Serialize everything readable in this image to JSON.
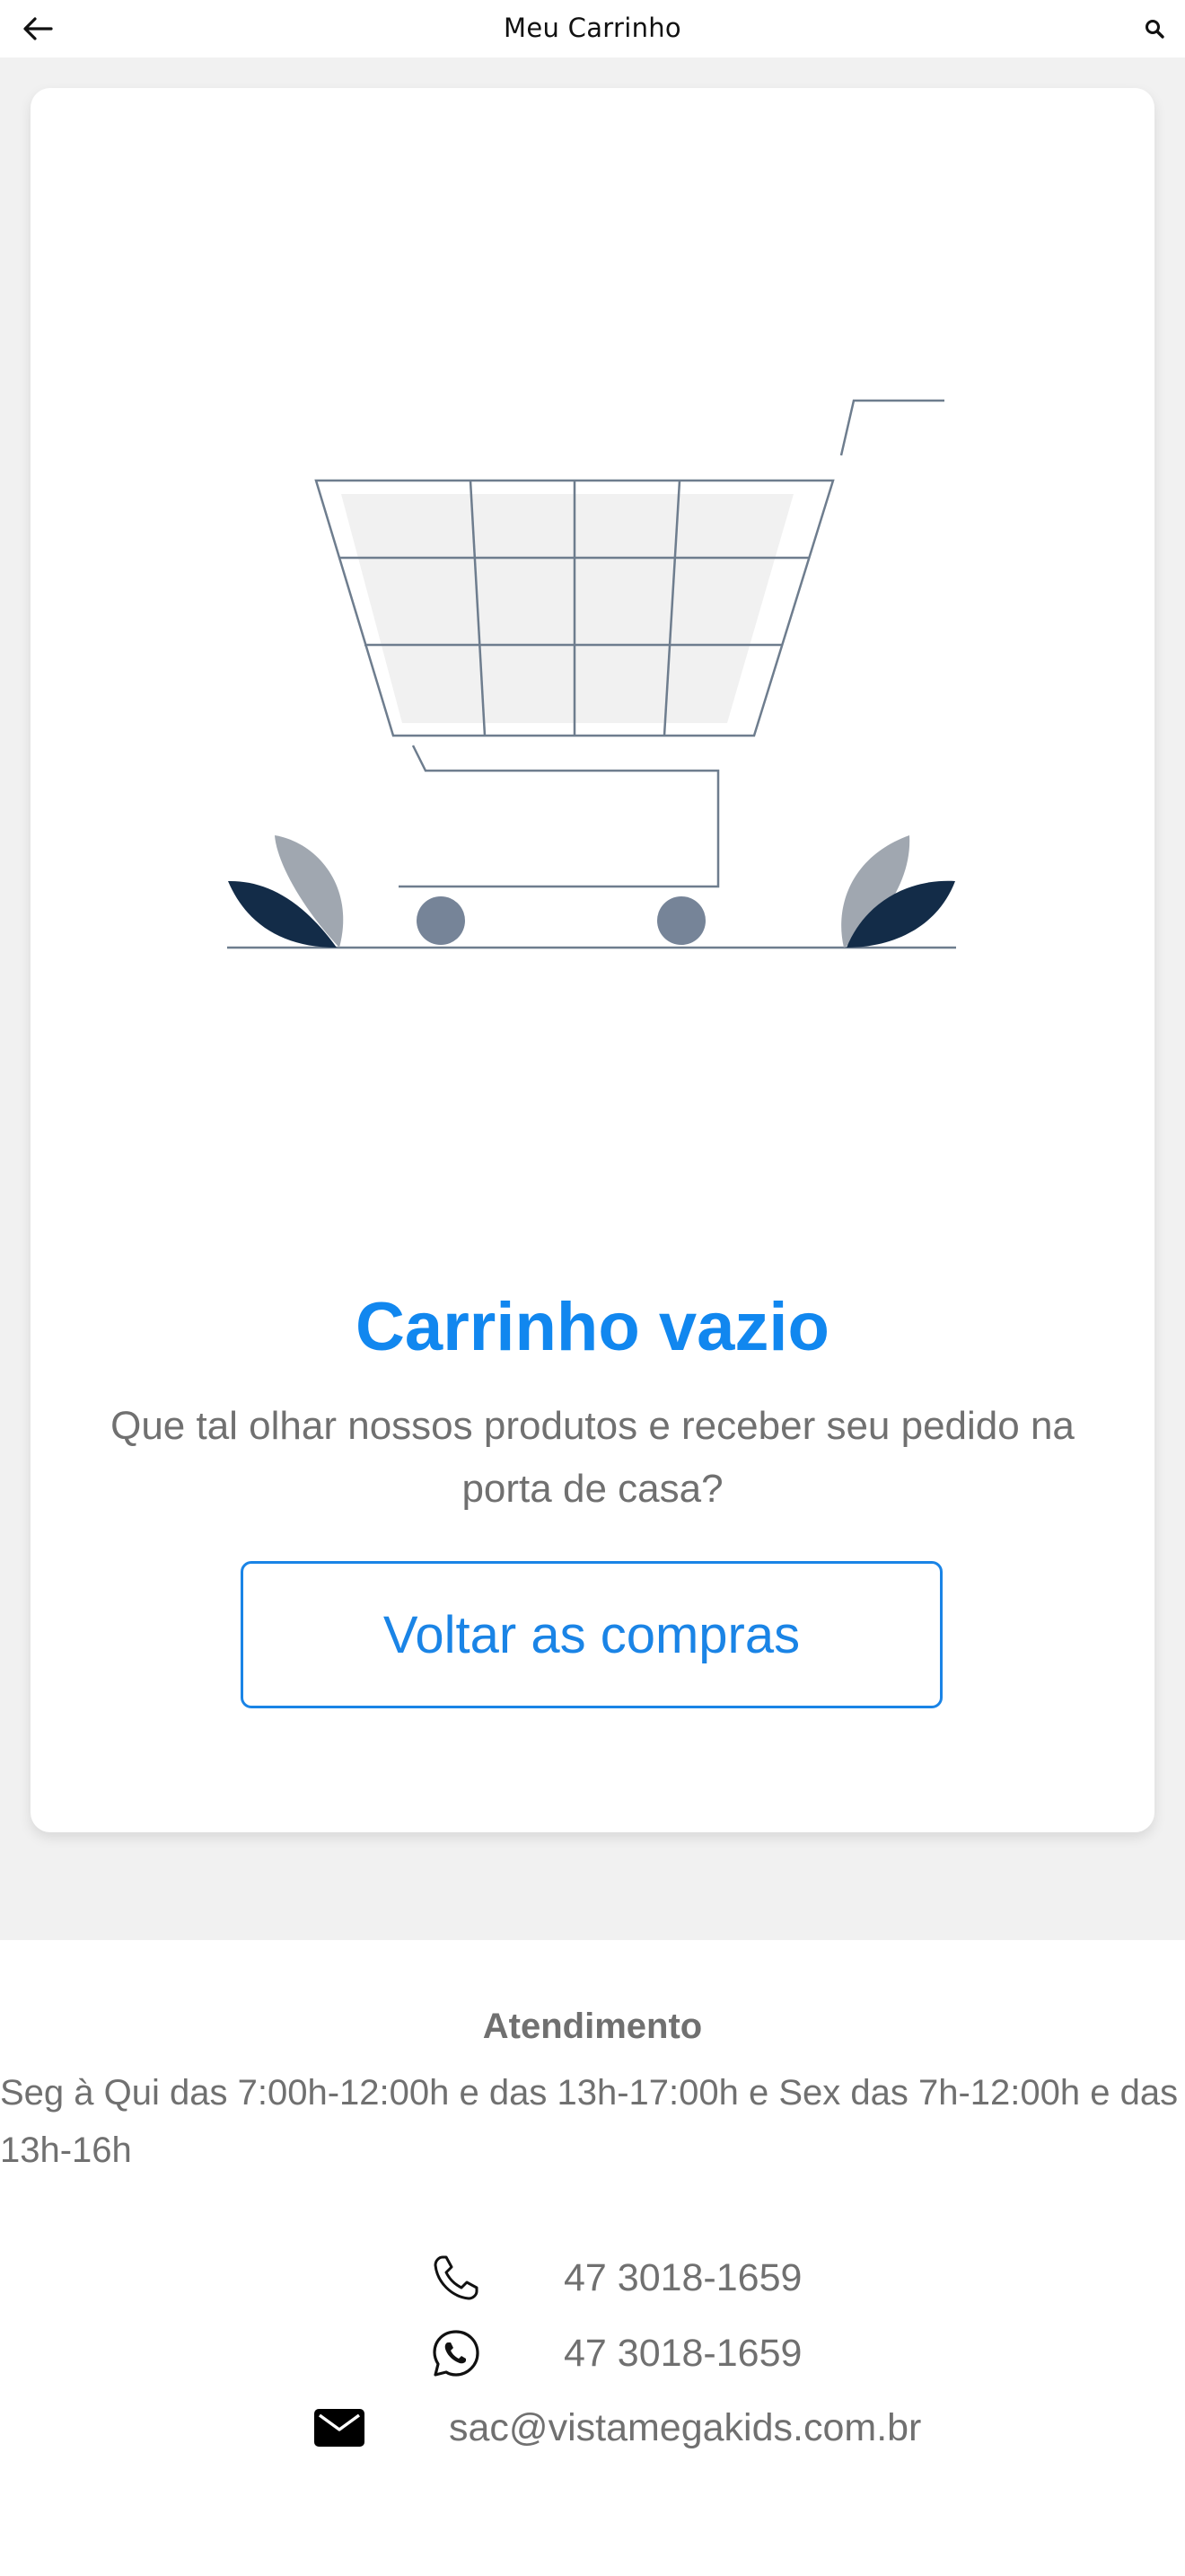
{
  "header": {
    "title": "Meu Carrinho",
    "back_icon": "arrow-left-icon",
    "search_icon": "search-icon"
  },
  "empty_cart": {
    "illustration": "shopping-cart-illustration",
    "title": "Carrinho vazio",
    "message": "Que tal olhar nossos produtos e receber seu pedido na porta de casa?",
    "button_label": "Voltar as compras"
  },
  "footer": {
    "heading": "Atendimento",
    "hours": "Seg à Qui das 7:00h-12:00h e das 13h-17:00h e Sex das 7h-12:00h e das 13h-16h",
    "phone": "47 3018-1659",
    "whatsapp": "47 3018-1659",
    "email": "sac@vistamegakids.com.br"
  },
  "colors": {
    "accent": "#1187ef",
    "page_background": "#f1f1f1",
    "card_background": "#ffffff",
    "text_muted": "#707070",
    "leaf_dark": "#132c48",
    "leaf_light": "#a0a7b0",
    "cart_line": "#6e7d8e"
  }
}
